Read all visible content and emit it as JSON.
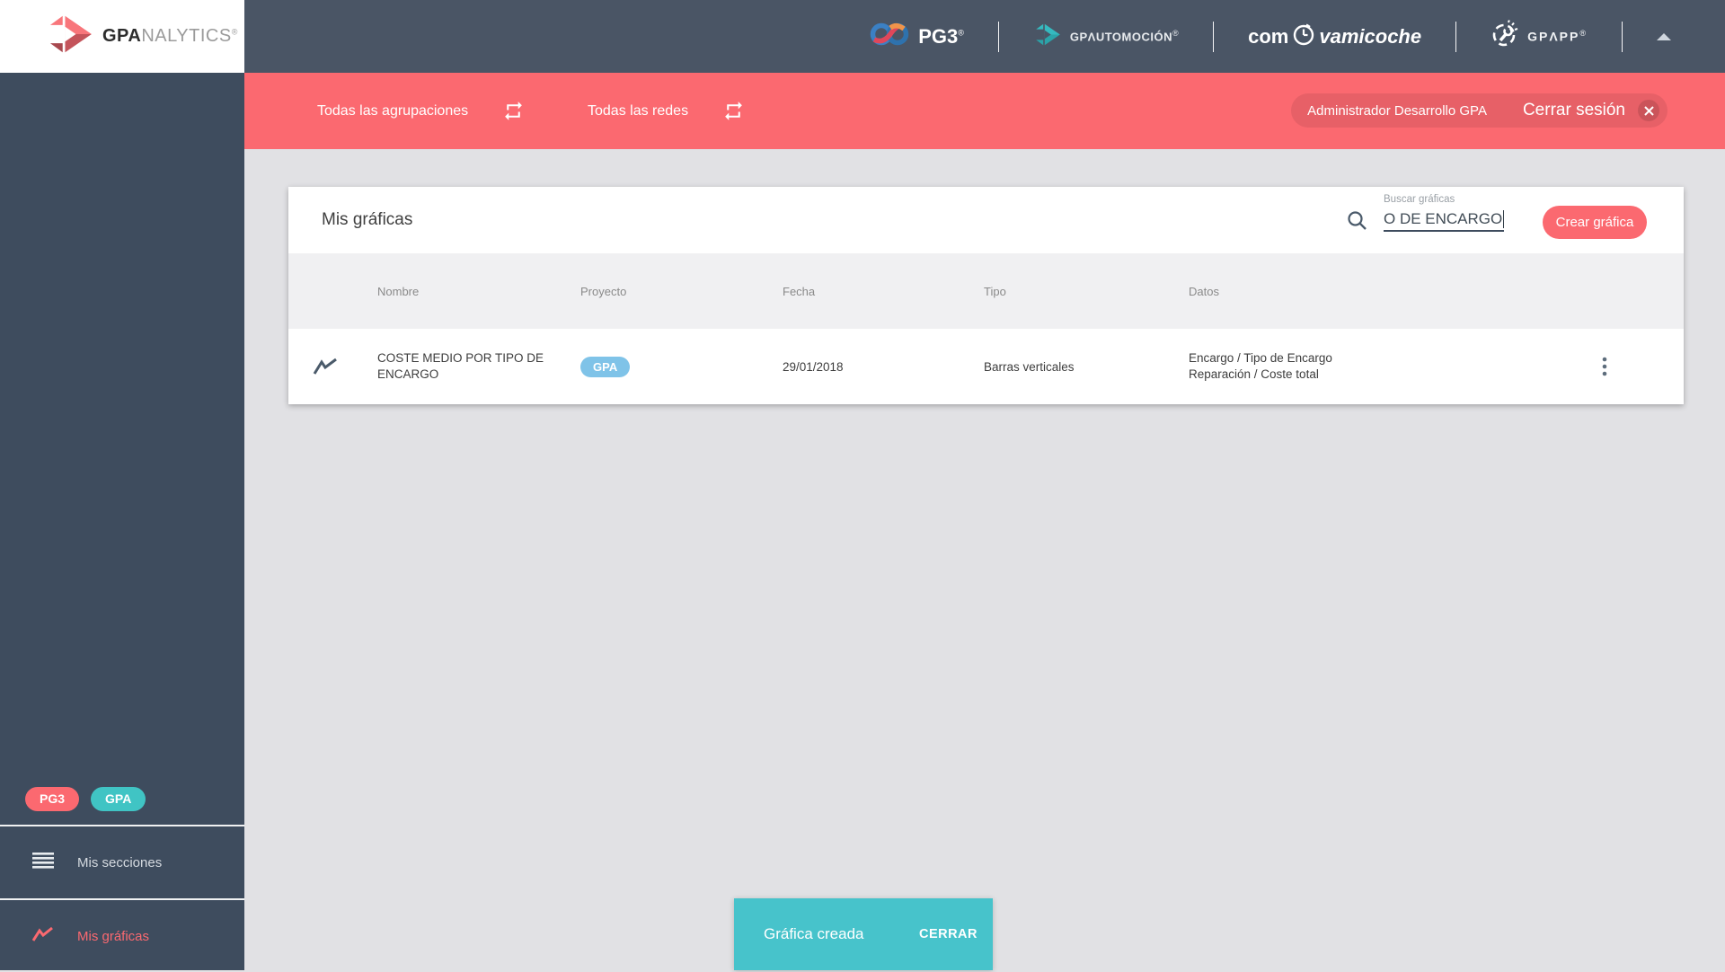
{
  "colors": {
    "accent_red": "#FB6970",
    "sidebar": "#3E4C5E",
    "topbar": "#4A5565",
    "teal_badge": "#40C4C4",
    "snackbar_teal": "#47C3CB",
    "project_badge_blue": "#7FC3E8"
  },
  "logo": {
    "gpa": "GPA",
    "nalytics": "NALYTICS",
    "reg": "®"
  },
  "topbar": {
    "pg3_label": "PG3",
    "pg3_reg": "®",
    "gpautomocion_label": "GPΛUTOMOCIÓN",
    "gpautomocion_reg": "®",
    "compra_prefix": "com",
    "compra_suffix": "vamicoche",
    "gpapp_label": "GPΛPP",
    "gpapp_reg": "®"
  },
  "filterbar": {
    "groupings": "Todas las agrupaciones",
    "networks": "Todas las redes",
    "user": "Administrador Desarrollo GPA",
    "logout": "Cerrar sesión"
  },
  "sidebar": {
    "badges": [
      {
        "label": "PG3"
      },
      {
        "label": "GPA"
      }
    ],
    "sections_item": "Mis secciones",
    "charts_item": "Mis gráficas"
  },
  "card": {
    "title": "Mis gráficas",
    "search_label": "Buscar gráficas",
    "search_value": "O DE ENCARGO",
    "create_button": "Crear gráfica"
  },
  "table": {
    "headers": [
      "Nombre",
      "Proyecto",
      "Fecha",
      "Tipo",
      "Datos"
    ],
    "rows": [
      {
        "nombre": "COSTE MEDIO POR TIPO DE ENCARGO",
        "proyecto": "GPA",
        "fecha": "29/01/2018",
        "tipo": "Barras verticales",
        "datos_line1": "Encargo / Tipo de Encargo",
        "datos_line2": "Reparación / Coste total"
      }
    ]
  },
  "snackbar": {
    "message": "Gráfica creada",
    "action": "CERRAR"
  }
}
